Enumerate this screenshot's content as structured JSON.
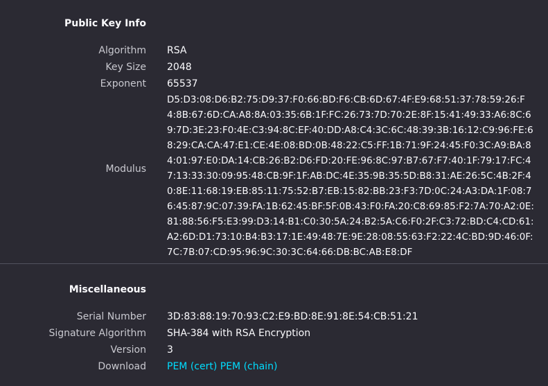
{
  "public_key": {
    "title": "Public Key Info",
    "algorithm_label": "Algorithm",
    "algorithm_value": "RSA",
    "key_size_label": "Key Size",
    "key_size_value": "2048",
    "exponent_label": "Exponent",
    "exponent_value": "65537",
    "modulus_label": "Modulus",
    "modulus_value": "D5:D3:08:D6:B2:75:D9:37:F0:66:BD:F6:CB:6D:67:4F:E9:68:51:37:78:59:26:F4:8B:67:6D:CA:A8:8A:03:35:6B:1F:FC:26:73:7D:70:2E:8F:15:41:49:33:A6:8C:69:7D:3E:23:F0:4E:C3:94:8C:EF:40:DD:A8:C4:3C:6C:48:39:3B:16:12:C9:96:FE:68:29:CA:CA:47:E1:CE:4E:08:BD:0B:48:22:C5:FF:1B:71:9F:24:45:F0:3C:A9:BA:84:01:97:E0:DA:14:CB:26:B2:D6:FD:20:FE:96:8C:97:B7:67:F7:40:1F:79:17:FC:47:13:33:30:09:95:48:CB:9F:1F:AB:DC:4E:35:9B:35:5D:B8:31:AE:26:5C:4B:2F:40:8E:11:68:19:EB:85:11:75:52:B7:EB:15:82:BB:23:F3:7D:0C:24:A3:DA:1F:08:76:45:87:9C:07:39:FA:1B:62:45:BF:5F:0B:43:F0:FA:20:C8:69:85:F2:7A:70:A2:0E:81:88:56:F5:E3:99:D3:14:B1:C0:30:5A:24:B2:5A:C6:F0:2F:C3:72:BD:C4:CD:61:A2:6D:D1:73:10:B4:B3:17:1E:49:48:7E:9E:28:08:55:63:F2:22:4C:BD:9D:46:0F:7C:7B:07:CD:95:96:9C:30:3C:64:66:DB:BC:AB:E8:DF"
  },
  "misc": {
    "title": "Miscellaneous",
    "serial_label": "Serial Number",
    "serial_value": "3D:83:88:19:70:93:C2:E9:BD:8E:91:8E:54:CB:51:21",
    "sig_alg_label": "Signature Algorithm",
    "sig_alg_value": "SHA-384 with RSA Encryption",
    "version_label": "Version",
    "version_value": "3",
    "download_label": "Download",
    "download_links": [
      "PEM (cert)",
      "PEM (chain)"
    ]
  },
  "colors": {
    "background": "#2b2a33",
    "text": "#fbfbfe",
    "label": "#c9c9d0",
    "link": "#00ddff",
    "divider": "#52525e"
  }
}
